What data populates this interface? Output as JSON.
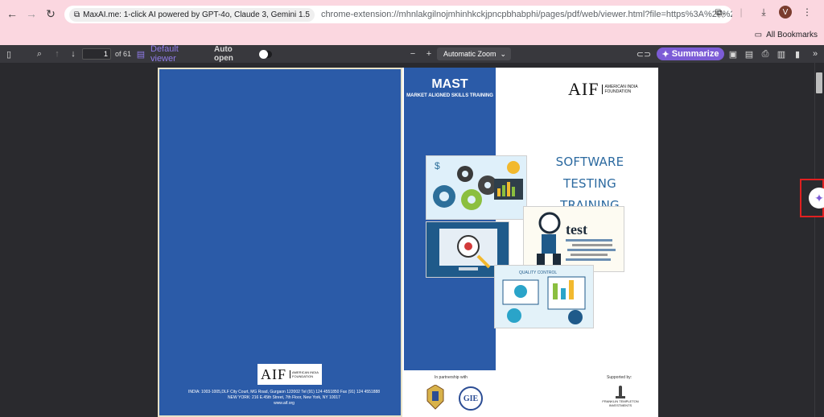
{
  "browser": {
    "tab_title": "MaxAI.me: 1-click AI powered by GPT-4o, Claude 3, Gemini 1.5",
    "url": "chrome-extension://mhnlakgilnojmhinhkckjpncpbhabphi/pages/pdf/web/viewer.html?file=https%3A%2F%2Fmaxaistorage.s3.amaz...",
    "profile_initial": "V",
    "all_bookmarks_label": "All Bookmarks"
  },
  "pdf_toolbar": {
    "page_number": "1",
    "page_total": "of 61",
    "default_viewer_label": "Default viewer",
    "auto_open_label": "Auto open",
    "zoom_label": "Automatic Zoom",
    "summarize_label": "Summarize"
  },
  "document": {
    "mast": "MAST",
    "mast_subtitle": "MARKET ALIGNED SKILLS TRAINING",
    "aif_mark": "AIF",
    "aif_full": "AMERICAN INDIA FOUNDATION",
    "title_line1": "SOFTWARE TESTING",
    "title_line2": "TRAINING MODULE",
    "address_line1": "INDIA: 1003-1005,DLF City Court, MG Road, Gurgaon 122002 Tel (91) 124 4551850 Fax (91) 124 4551888",
    "address_line2": "NEW YORK: 216 E.45th Street, 7th Floor, New York, NY 10017",
    "address_line3": "www.aif.org",
    "partnership_label": "In partnership with",
    "supported_label": "Supported by:",
    "franklin_label": "FRANKLIN TEMPLETON INVESTMENTS",
    "test_word": "test",
    "quality_control_label": "QUALITY CONTROL",
    "gie_mark": "GIE"
  },
  "colors": {
    "browser_bg": "#fbd7e0",
    "toolbar_bg": "#38383d",
    "viewer_bg": "#2a2a2e",
    "cover_blue": "#2b5ba8",
    "accent_purple": "#7c5cd6",
    "highlight_red": "#e02020"
  }
}
